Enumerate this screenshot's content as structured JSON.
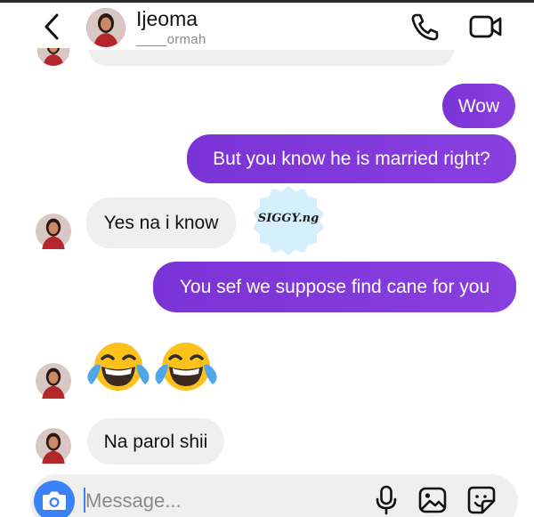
{
  "header": {
    "contact_name": "Ijeoma",
    "contact_handle": "____ormah"
  },
  "messages": [
    {
      "direction": "outgoing",
      "text": "Wow"
    },
    {
      "direction": "outgoing",
      "text": "But you know he is married right?"
    },
    {
      "direction": "incoming",
      "text": "Yes na i know"
    },
    {
      "direction": "outgoing",
      "text": "You sef we suppose find cane for you"
    },
    {
      "direction": "incoming",
      "text": "😂😂",
      "type": "emoji",
      "emoji_name": "face-with-tears-of-joy"
    },
    {
      "direction": "incoming",
      "text": "Na parol shii"
    }
  ],
  "watermark": "SIGGY.ng",
  "composer": {
    "placeholder": "Message..."
  },
  "colors": {
    "outgoing_bubble": "#7a33d6",
    "incoming_bubble": "#efefef",
    "camera_button": "#3b82f6",
    "watermark_badge": "#d6f0fb"
  }
}
